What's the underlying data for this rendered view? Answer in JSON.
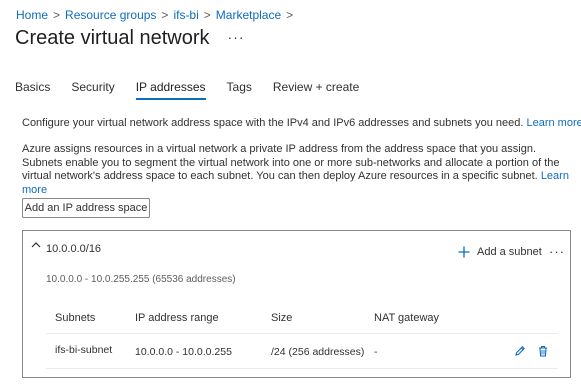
{
  "breadcrumb": {
    "items": [
      "Home",
      "Resource groups",
      "ifs-bi",
      "Marketplace"
    ],
    "separator": ">"
  },
  "page": {
    "title": "Create virtual network",
    "more_label": "···"
  },
  "tabs": [
    {
      "label": "Basics",
      "active": false
    },
    {
      "label": "Security",
      "active": false
    },
    {
      "label": "IP addresses",
      "active": true
    },
    {
      "label": "Tags",
      "active": false
    },
    {
      "label": "Review + create",
      "active": false
    }
  ],
  "intro": {
    "text": "Configure your virtual network address space with the IPv4 and IPv6 addresses and subnets you need.",
    "learn_more": "Learn more"
  },
  "description": {
    "text": "Azure assigns resources in a virtual network a private IP address from the address space that you assign. Subnets enable you to segment the virtual network into one or more sub-networks and allocate a portion of the virtual network's address space to each subnet. You can then deploy Azure resources in a specific subnet.",
    "learn_more": "Learn more"
  },
  "add_space_button": "Add an IP address space",
  "address_space": {
    "cidr": "10.0.0.0/16",
    "range_summary": "10.0.0.0 - 10.0.255.255 (65536 addresses)",
    "add_subnet_label": "Add a subnet",
    "more_label": "···",
    "columns": [
      "Subnets",
      "IP address range",
      "Size",
      "NAT gateway"
    ],
    "subnets": [
      {
        "name": "ifs-bi-subnet",
        "range": "10.0.0.0 - 10.0.0.255",
        "size": "/24 (256 addresses)",
        "nat_gateway": "-"
      }
    ]
  },
  "colors": {
    "accent": "#0f6cbd",
    "text": "#323130",
    "muted": "#605e5c",
    "border": "#8a8886"
  }
}
